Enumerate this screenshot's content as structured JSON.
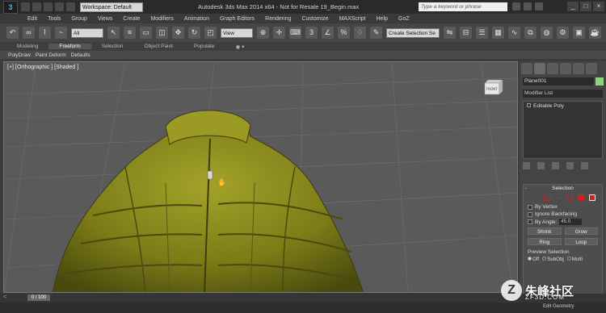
{
  "title_bar": {
    "workspace": "Workspace: Default",
    "window_title": "Autodesk 3ds Max  2014 x64  -  Not for Resale    19_Begin.max",
    "search_placeholder": "Type a keyword or phrase"
  },
  "menu": [
    "Edit",
    "Tools",
    "Group",
    "Views",
    "Create",
    "Modifiers",
    "Animation",
    "Graph Editors",
    "Rendering",
    "Customize",
    "MAXScript",
    "Help",
    "GoZ"
  ],
  "main_toolbar": {
    "selection_filter": "All",
    "reference_coord": "View",
    "selection_set": "Create Selection Se"
  },
  "ribbon": {
    "tabs": [
      "Modeling",
      "Freeform",
      "Selection",
      "Object Paint",
      "Populate"
    ],
    "active_tab": "Freeform",
    "sub_items": [
      "PolyDraw",
      "Paint Deform",
      "Defaults"
    ]
  },
  "viewport": {
    "label": "[+] [Orthographic ] [Shaded ]",
    "cube_label": "FRONT"
  },
  "command_panel": {
    "object_name": "Plane001",
    "modifier_list": "Modifier List",
    "stack_item": "Editable Poly",
    "selection_rollout": {
      "title": "Selection",
      "minus": "-",
      "by_vertex": "By Vertex",
      "ignore_backfacing": "Ignore Backfacing",
      "by_angle": "By Angle:",
      "angle_value": "45.0",
      "shrink": "Shrink",
      "grow": "Grow",
      "ring": "Ring",
      "loop": "Loop",
      "preview_selection": "Preview Selection",
      "preview_options": [
        "Off",
        "SubObj",
        "Multi"
      ]
    }
  },
  "timeline": {
    "frame": "0 / 100",
    "arrow": "<"
  },
  "status": {
    "edit_geometry": "Edit Geometry"
  },
  "watermark": {
    "logo": "Z",
    "text": "朱峰社区",
    "url": "ZF3D.COM"
  },
  "colors": {
    "jacket": "#8a8a1c",
    "jacket_shadow": "#4a4a0e",
    "viewport_bg": "#5a5a5a",
    "object_color": "#8fd47b",
    "selection_red": "#cc2222"
  }
}
